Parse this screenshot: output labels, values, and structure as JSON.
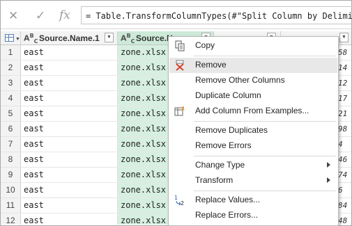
{
  "formula_bar": {
    "cancel_icon": "close-icon",
    "commit_icon": "check-icon",
    "fx_label": "fx",
    "formula": "= Table.TransformColumnTypes(#\"Split Column by Delimiter\","
  },
  "columns": [
    {
      "type_icon": "ABC",
      "name": "Source.Name.1"
    },
    {
      "type_icon": "ABC",
      "name": "Source.Na"
    },
    {
      "type_icon": "table",
      "name": ""
    },
    {
      "type_icon": "number",
      "name": ""
    }
  ],
  "rows": [
    {
      "num": "1",
      "c1": "east",
      "c2": "zone.xlsx",
      "c4": "58"
    },
    {
      "num": "2",
      "c1": "east",
      "c2": "zone.xlsx",
      "c4": "14"
    },
    {
      "num": "3",
      "c1": "east",
      "c2": "zone.xlsx",
      "c4": "12"
    },
    {
      "num": "4",
      "c1": "east",
      "c2": "zone.xlsx",
      "c4": "17"
    },
    {
      "num": "5",
      "c1": "east",
      "c2": "zone.xlsx",
      "c4": "21"
    },
    {
      "num": "6",
      "c1": "east",
      "c2": "zone.xlsx",
      "c4": "98"
    },
    {
      "num": "7",
      "c1": "east",
      "c2": "zone.xlsx",
      "c4": "4"
    },
    {
      "num": "8",
      "c1": "east",
      "c2": "zone.xlsx",
      "c4": "46"
    },
    {
      "num": "9",
      "c1": "east",
      "c2": "zone.xlsx",
      "c4": "74"
    },
    {
      "num": "10",
      "c1": "east",
      "c2": "zone.xlsx",
      "c4": "6"
    },
    {
      "num": "11",
      "c1": "east",
      "c2": "zone.xlsx",
      "c4": "84"
    },
    {
      "num": "12",
      "c1": "east",
      "c2": "zone.xlsx",
      "c4": "48"
    }
  ],
  "context_menu": {
    "copy": "Copy",
    "remove": "Remove",
    "remove_other_columns": "Remove Other Columns",
    "duplicate_column": "Duplicate Column",
    "add_column_from_examples": "Add Column From Examples...",
    "remove_duplicates": "Remove Duplicates",
    "remove_errors": "Remove Errors",
    "change_type": "Change Type",
    "transform": "Transform",
    "replace_values": "Replace Values...",
    "replace_errors": "Replace Errors..."
  },
  "colors": {
    "selected_column": "#d6efe0",
    "selected_header": "#cde9d8",
    "menu_hover": "#e8e8e8",
    "remove_icon": "#d9432f"
  }
}
